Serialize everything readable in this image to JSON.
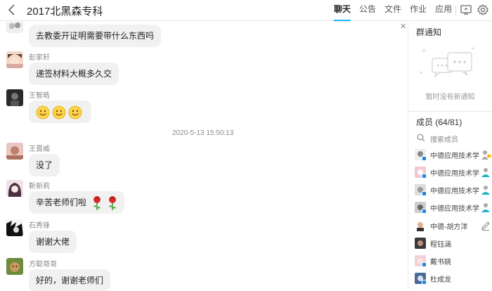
{
  "header": {
    "title": "2017北黑森专科",
    "tabs": [
      {
        "label": "聊天",
        "active": true
      },
      {
        "label": "公告",
        "active": false
      },
      {
        "label": "文件",
        "active": false
      },
      {
        "label": "作业",
        "active": false
      },
      {
        "label": "应用",
        "active": false
      }
    ],
    "icons": [
      "back-icon",
      "screen-share-icon",
      "settings-icon"
    ],
    "accent_color": "#12b7f5"
  },
  "chat": {
    "messages": [
      {
        "sender": "",
        "text": "去教委开证明需要带什么东西吗",
        "avatar": "avatar-flowers"
      },
      {
        "sender": "彭家轩",
        "text": "递签材料大概多久交",
        "avatar": "avatar-anime-boy"
      },
      {
        "sender": "王智皓",
        "text": "",
        "emojis": [
          "smile-emoji",
          "smile-emoji",
          "smile-emoji"
        ],
        "avatar": "avatar-dark-figure"
      },
      {
        "sender": "王晋威",
        "text": "没了",
        "avatar": "avatar-pink-photo"
      },
      {
        "sender": "靳新莉",
        "text": "辛苦老师们啦",
        "stickers": [
          "rose-icon",
          "rose-icon"
        ],
        "avatar": "avatar-anime-girl"
      },
      {
        "sender": "石秀锋",
        "text": "谢谢大佬",
        "avatar": "avatar-black-white"
      },
      {
        "sender": "方聪哥哥",
        "text": "好的，谢谢老师们",
        "avatar": "avatar-green-dog"
      }
    ],
    "timestamp": "2020-5-13 15:50:13"
  },
  "panel": {
    "notice_title": "群通知",
    "notice_empty": "暂时没有新通知",
    "members_title": "成员 (64/81)",
    "search_placeholder": "搜索成员",
    "members": [
      {
        "name": "中德应用技术学",
        "role": "owner-icon"
      },
      {
        "name": "中德应用技术学",
        "role": "admin-icon"
      },
      {
        "name": "中德应用技术学",
        "role": "admin-icon"
      },
      {
        "name": "中德应用技术学",
        "role": "admin-icon"
      },
      {
        "name": "中德-胡方洋",
        "role": "edit-icon"
      },
      {
        "name": "程钰涵",
        "role": ""
      },
      {
        "name": "戴书娆",
        "role": ""
      },
      {
        "name": "杜成龙",
        "role": ""
      }
    ]
  }
}
